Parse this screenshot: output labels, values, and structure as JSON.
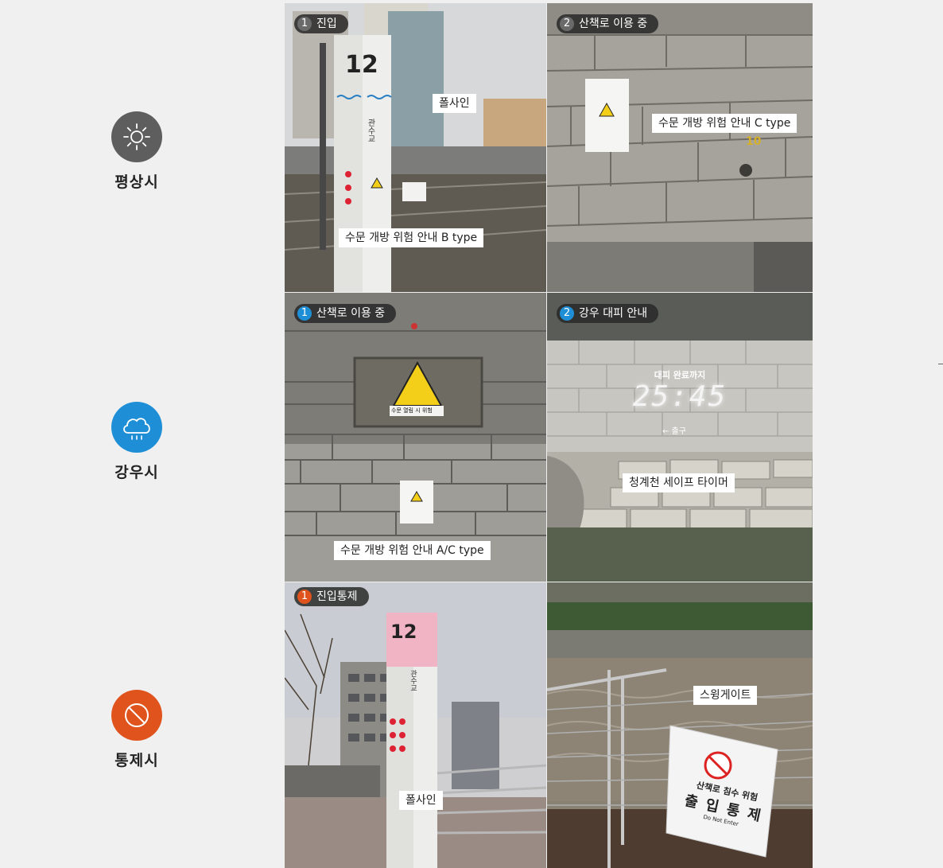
{
  "modes": [
    {
      "label": "평상시",
      "icon": "sun-icon",
      "color": "#5e5e5e"
    },
    {
      "label": "강우시",
      "icon": "rain-cloud-icon",
      "color": "#1e8fd6"
    },
    {
      "label": "통제시",
      "icon": "prohibition-icon",
      "color": "#e0531c"
    }
  ],
  "panels": {
    "normal_1": {
      "step_num": "1",
      "step_label": "진입",
      "captions": [
        "폴사인",
        "수문 개방 위험 안내 B type"
      ],
      "pole_number": "12",
      "pole_name": "관수교"
    },
    "normal_2": {
      "step_num": "2",
      "step_label": "산책로 이용 중",
      "captions": [
        "수문 개방 위험 안내 C type"
      ],
      "marker": "10"
    },
    "rain_1": {
      "step_num": "1",
      "step_label": "산책로 이용 중",
      "captions": [
        "수문 개방 위험 안내 A/C type"
      ],
      "sign_text": "수문 열림 시 위험"
    },
    "rain_2": {
      "step_num": "2",
      "step_label": "강우 대피 안내",
      "captions": [
        "청계천 세이프 타이머"
      ],
      "timer_title": "대피 완료까지",
      "timer_value": "25:45",
      "exit_text": "← 출구"
    },
    "control_1": {
      "step_num": "1",
      "step_label": "진입통제",
      "captions": [
        "폴사인"
      ],
      "pole_number": "12",
      "pole_name": "관수교"
    },
    "control_2": {
      "captions": [
        "스윙게이트"
      ],
      "gate_lines": [
        "산책로 침수 위험",
        "출 입 통 제",
        "Do Not Enter"
      ]
    }
  },
  "colors": {
    "normal_badge": "#555555",
    "rain_badge": "#1e8fd6",
    "control_badge": "#e0531c"
  }
}
